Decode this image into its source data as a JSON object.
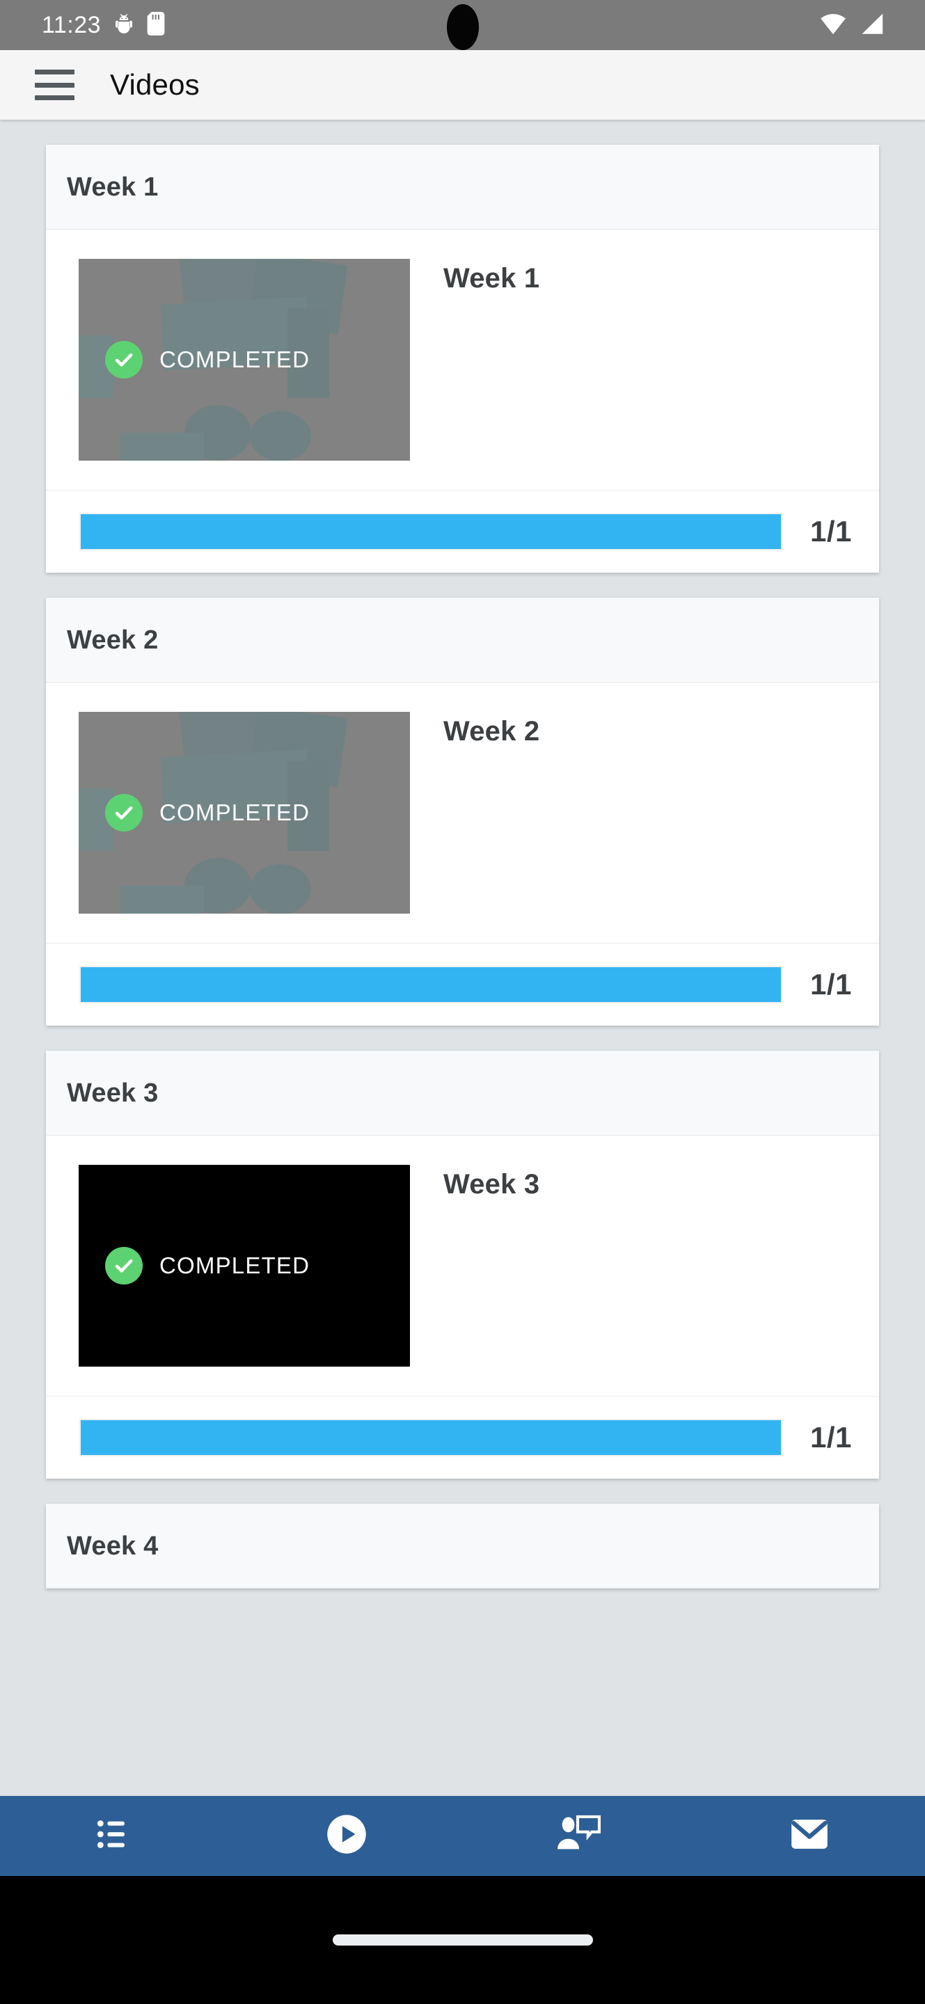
{
  "status_bar": {
    "time": "11:23",
    "icons_left": [
      "android-bug-icon",
      "sd-card-icon"
    ],
    "icons_right": [
      "wifi-icon",
      "cellular-signal-icon"
    ],
    "background_color": "#7b7b7b"
  },
  "app_bar": {
    "menu_icon": "hamburger-menu-icon",
    "title": "Videos",
    "background_color": "#f5f5f5"
  },
  "theme": {
    "page_background": "#dfe3e6",
    "card_background": "#ffffff",
    "card_header_background": "#f8f9fa",
    "progress_fill": "#33b4f2",
    "completed_badge": "#5dd272",
    "nav_background": "#2d5f96",
    "text_primary": "#3c4043"
  },
  "cards": [
    {
      "header": "Week 1",
      "video": {
        "title": "Week 1",
        "badge_label": "COMPLETED",
        "badge_icon": "check-circle-icon",
        "thumbnail_style": "gray-desaturated-photo"
      },
      "progress": {
        "label": "1/1",
        "completed": 1,
        "total": 1,
        "percent": 100
      }
    },
    {
      "header": "Week 2",
      "video": {
        "title": "Week 2",
        "badge_label": "COMPLETED",
        "badge_icon": "check-circle-icon",
        "thumbnail_style": "gray-desaturated-photo"
      },
      "progress": {
        "label": "1/1",
        "completed": 1,
        "total": 1,
        "percent": 100
      }
    },
    {
      "header": "Week 3",
      "video": {
        "title": "Week 3",
        "badge_label": "COMPLETED",
        "badge_icon": "check-circle-icon",
        "thumbnail_style": "black"
      },
      "progress": {
        "label": "1/1",
        "completed": 1,
        "total": 1,
        "percent": 100
      }
    },
    {
      "header": "Week 4",
      "video": null,
      "progress": null
    }
  ],
  "bottom_nav": {
    "items": [
      {
        "icon": "list-icon",
        "label": ""
      },
      {
        "icon": "play-circle-icon",
        "label": ""
      },
      {
        "icon": "person-message-icon",
        "label": ""
      },
      {
        "icon": "envelope-icon",
        "label": ""
      }
    ]
  },
  "gesture_bar": {
    "handle": "home-gesture-pill"
  }
}
